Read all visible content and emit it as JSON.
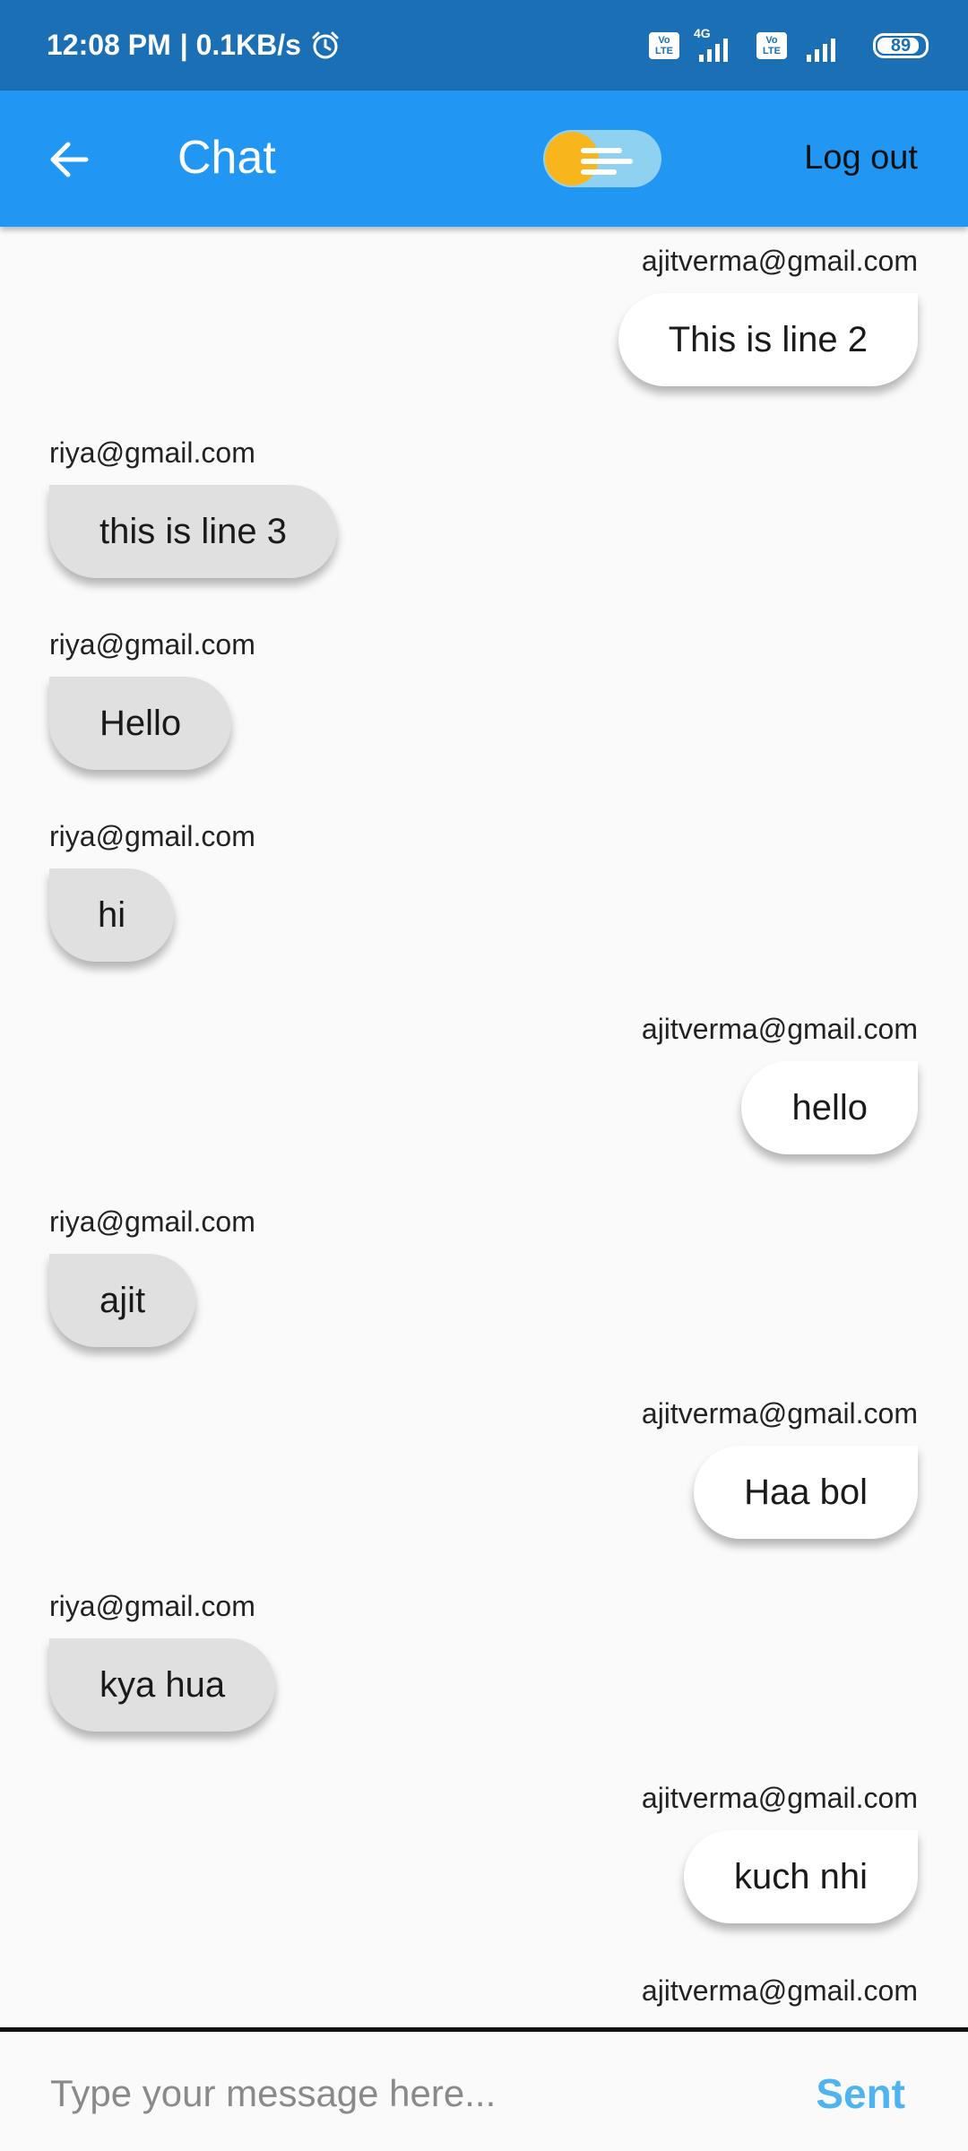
{
  "status_bar": {
    "time": "12:08 PM",
    "speed": "| 0.1KB/s",
    "volte_label": "Vo LTE",
    "network": "4G",
    "battery": "89"
  },
  "app_bar": {
    "title": "Chat",
    "logout_label": "Log out"
  },
  "messages": [
    {
      "sender": "ajitverma@gmail.com",
      "text": "This is line 2"
    },
    {
      "sender": "riya@gmail.com",
      "text": "this is line 3"
    },
    {
      "sender": "riya@gmail.com",
      "text": "Hello"
    },
    {
      "sender": "riya@gmail.com",
      "text": "hi"
    },
    {
      "sender": "ajitverma@gmail.com",
      "text": "hello"
    },
    {
      "sender": "riya@gmail.com",
      "text": "ajit"
    },
    {
      "sender": "ajitverma@gmail.com",
      "text": "Haa bol"
    },
    {
      "sender": "riya@gmail.com",
      "text": "kya hua"
    },
    {
      "sender": "ajitverma@gmail.com",
      "text": "kuch nhi"
    },
    {
      "sender": "ajitverma@gmail.com",
      "text": ""
    }
  ],
  "input": {
    "placeholder": "Type your message here...",
    "value": "",
    "send_label": "Sent"
  }
}
